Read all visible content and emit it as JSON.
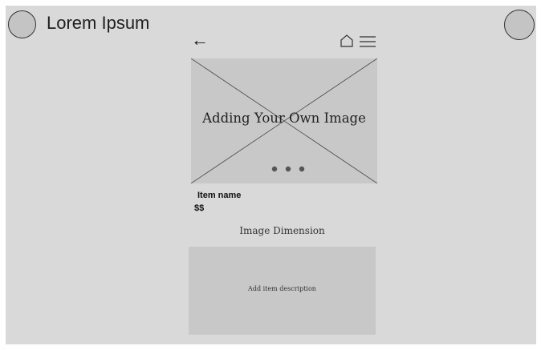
{
  "app": {
    "brand": "Lorem Ipsum"
  },
  "header": {
    "back_icon": "arrow-left",
    "home_icon": "home-outline",
    "menu_icon": "hamburger"
  },
  "hero": {
    "placeholder_text": "Adding Your Own Image",
    "carousel_dots": 3
  },
  "item": {
    "name": "Item name",
    "price": "$$"
  },
  "image_dimension_label": "Image Dimension",
  "description": {
    "placeholder": "Add item description"
  },
  "colors": {
    "frame_bg": "#d9d9d9",
    "placeholder_bg": "#c8c8c8",
    "text": "#111111"
  }
}
